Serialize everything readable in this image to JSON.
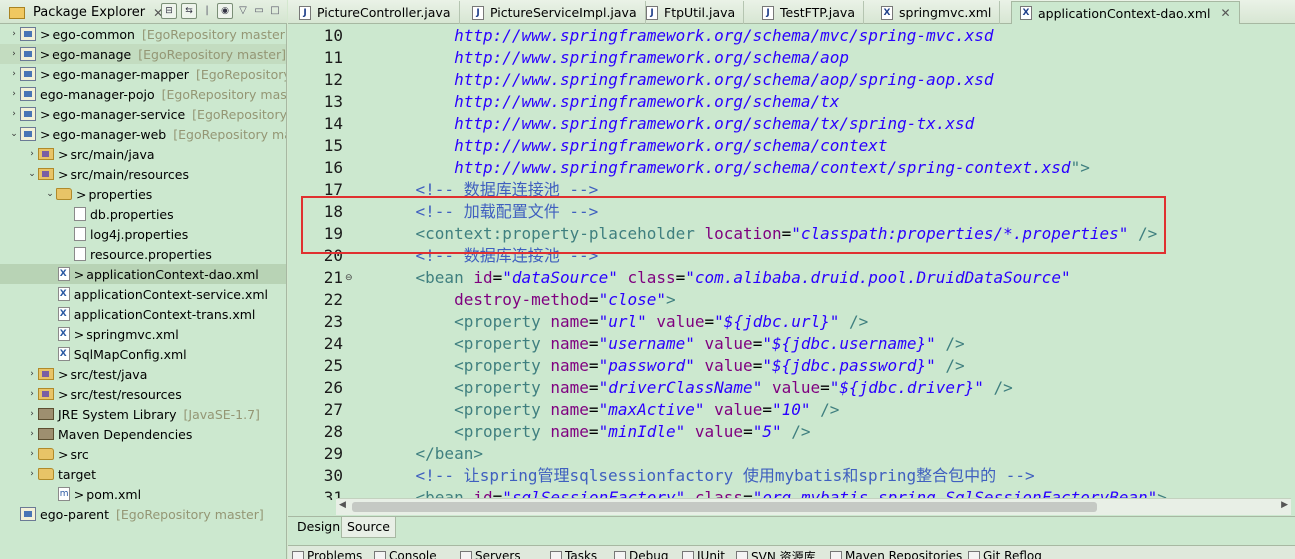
{
  "explorer": {
    "title": "Package Explorer",
    "items": [
      {
        "label": "ego-common",
        "deco": "[EgoRepository master]",
        "pre": ">"
      },
      {
        "label": "ego-manage",
        "deco": "[EgoRepository master]",
        "pre": ">"
      },
      {
        "label": "ego-manager-mapper",
        "deco": "[EgoRepository",
        "pre": ">"
      },
      {
        "label": "ego-manager-pojo",
        "deco": "[EgoRepository mas",
        "pre": ""
      },
      {
        "label": "ego-manager-service",
        "deco": "[EgoRepository",
        "pre": ">"
      },
      {
        "label": "ego-manager-web",
        "deco": "[EgoRepository ma",
        "pre": ">"
      },
      {
        "label": "src/main/java",
        "deco": "",
        "pre": ">"
      },
      {
        "label": "src/main/resources",
        "deco": "",
        "pre": ">"
      },
      {
        "label": "properties",
        "deco": "",
        "pre": ">"
      },
      {
        "label": "db.properties",
        "deco": "",
        "pre": ""
      },
      {
        "label": "log4j.properties",
        "deco": "",
        "pre": ""
      },
      {
        "label": "resource.properties",
        "deco": "",
        "pre": ""
      },
      {
        "label": "applicationContext-dao.xml",
        "deco": "",
        "pre": ">"
      },
      {
        "label": "applicationContext-service.xml",
        "deco": "",
        "pre": ""
      },
      {
        "label": "applicationContext-trans.xml",
        "deco": "",
        "pre": ""
      },
      {
        "label": "springmvc.xml",
        "deco": "",
        "pre": ">"
      },
      {
        "label": "SqlMapConfig.xml",
        "deco": "",
        "pre": ""
      },
      {
        "label": "src/test/java",
        "deco": "",
        "pre": ">"
      },
      {
        "label": "src/test/resources",
        "deco": "",
        "pre": ">"
      },
      {
        "label": "JRE System Library",
        "deco": "[JavaSE-1.7]",
        "pre": ""
      },
      {
        "label": "Maven Dependencies",
        "deco": "",
        "pre": ""
      },
      {
        "label": "src",
        "deco": "",
        "pre": ">"
      },
      {
        "label": "target",
        "deco": "",
        "pre": ""
      },
      {
        "label": "pom.xml",
        "deco": "",
        "pre": ">"
      },
      {
        "label": "ego-parent",
        "deco": "[EgoRepository master]",
        "pre": ""
      }
    ]
  },
  "editor": {
    "tabs": [
      {
        "label": "PictureController.java",
        "icon": "java-file-icon"
      },
      {
        "label": "PictureServiceImpl.java",
        "icon": "java-file-icon"
      },
      {
        "label": "FtpUtil.java",
        "icon": "java-file-icon"
      },
      {
        "label": "TestFTP.java",
        "icon": "java-file-icon"
      },
      {
        "label": "springmvc.xml",
        "icon": "xml-file-icon"
      },
      {
        "label": "applicationContext-dao.xml",
        "icon": "xml-file-icon"
      }
    ],
    "lines": [
      {
        "n": "10",
        "segs": [
          [
            "url",
            "        http://www.springframework.org/schema/mvc/spring-mvc.xsd"
          ]
        ]
      },
      {
        "n": "11",
        "segs": [
          [
            "url",
            "        http://www.springframework.org/schema/aop"
          ]
        ]
      },
      {
        "n": "12",
        "segs": [
          [
            "url",
            "        http://www.springframework.org/schema/aop/spring-aop.xsd"
          ]
        ]
      },
      {
        "n": "13",
        "segs": [
          [
            "url",
            "        http://www.springframework.org/schema/tx"
          ]
        ]
      },
      {
        "n": "14",
        "segs": [
          [
            "url",
            "        http://www.springframework.org/schema/tx/spring-tx.xsd"
          ]
        ]
      },
      {
        "n": "15",
        "segs": [
          [
            "url",
            "        http://www.springframework.org/schema/context"
          ]
        ]
      },
      {
        "n": "16",
        "segs": [
          [
            "url",
            "        http://www.springframework.org/schema/context/spring-context.xsd"
          ],
          [
            "tg",
            "\">"
          ]
        ]
      },
      {
        "n": "17",
        "segs": [
          [
            "cm",
            "    <!-- 数据库连接池 -->"
          ]
        ]
      },
      {
        "n": "18",
        "segs": [
          [
            "cm",
            "    <!-- 加载配置文件 -->"
          ]
        ]
      },
      {
        "n": "19",
        "segs": [
          [
            "tg",
            "    <context:property-placeholder "
          ],
          [
            "at",
            "location"
          ],
          [
            "pl",
            "="
          ],
          [
            "vl",
            "\"classpath:properties/*.properties\""
          ],
          [
            "tg",
            " />"
          ]
        ]
      },
      {
        "n": "20",
        "segs": [
          [
            "cm",
            "    <!-- 数据库连接池 -->"
          ]
        ]
      },
      {
        "n": "21",
        "segs": [
          [
            "tg",
            "    <bean "
          ],
          [
            "at",
            "id"
          ],
          [
            "pl",
            "="
          ],
          [
            "vl",
            "\"dataSource\""
          ],
          [
            "at",
            " class"
          ],
          [
            "pl",
            "="
          ],
          [
            "vl",
            "\"com.alibaba.druid.pool.DruidDataSource\""
          ]
        ],
        "fold": true
      },
      {
        "n": "22",
        "segs": [
          [
            "at",
            "        destroy-method"
          ],
          [
            "pl",
            "="
          ],
          [
            "vl",
            "\"close\""
          ],
          [
            "tg",
            ">"
          ]
        ]
      },
      {
        "n": "23",
        "segs": [
          [
            "tg",
            "        <property "
          ],
          [
            "at",
            "name"
          ],
          [
            "pl",
            "="
          ],
          [
            "vl",
            "\"url\""
          ],
          [
            "at",
            " value"
          ],
          [
            "pl",
            "="
          ],
          [
            "vl",
            "\"${jdbc.url}\""
          ],
          [
            "tg",
            " />"
          ]
        ]
      },
      {
        "n": "24",
        "segs": [
          [
            "tg",
            "        <property "
          ],
          [
            "at",
            "name"
          ],
          [
            "pl",
            "="
          ],
          [
            "vl",
            "\"username\""
          ],
          [
            "at",
            " value"
          ],
          [
            "pl",
            "="
          ],
          [
            "vl",
            "\"${jdbc.username}\""
          ],
          [
            "tg",
            " />"
          ]
        ]
      },
      {
        "n": "25",
        "segs": [
          [
            "tg",
            "        <property "
          ],
          [
            "at",
            "name"
          ],
          [
            "pl",
            "="
          ],
          [
            "vl",
            "\"password\""
          ],
          [
            "at",
            " value"
          ],
          [
            "pl",
            "="
          ],
          [
            "vl",
            "\"${jdbc.password}\""
          ],
          [
            "tg",
            " />"
          ]
        ]
      },
      {
        "n": "26",
        "segs": [
          [
            "tg",
            "        <property "
          ],
          [
            "at",
            "name"
          ],
          [
            "pl",
            "="
          ],
          [
            "vl",
            "\"driverClassName\""
          ],
          [
            "at",
            " value"
          ],
          [
            "pl",
            "="
          ],
          [
            "vl",
            "\"${jdbc.driver}\""
          ],
          [
            "tg",
            " />"
          ]
        ]
      },
      {
        "n": "27",
        "segs": [
          [
            "tg",
            "        <property "
          ],
          [
            "at",
            "name"
          ],
          [
            "pl",
            "="
          ],
          [
            "vl",
            "\"maxActive\""
          ],
          [
            "at",
            " value"
          ],
          [
            "pl",
            "="
          ],
          [
            "vl",
            "\"10\""
          ],
          [
            "tg",
            " />"
          ]
        ]
      },
      {
        "n": "28",
        "segs": [
          [
            "tg",
            "        <property "
          ],
          [
            "at",
            "name"
          ],
          [
            "pl",
            "="
          ],
          [
            "vl",
            "\"minIdle\""
          ],
          [
            "at",
            " value"
          ],
          [
            "pl",
            "="
          ],
          [
            "vl",
            "\"5\""
          ],
          [
            "tg",
            " />"
          ]
        ]
      },
      {
        "n": "29",
        "segs": [
          [
            "tg",
            "    </bean>"
          ]
        ]
      },
      {
        "n": "30",
        "segs": [
          [
            "cm",
            "    <!-- 让spring管理sqlsessionfactory 使用mybatis和spring整合包中的 -->"
          ]
        ]
      },
      {
        "n": "31",
        "segs": [
          [
            "tg",
            "    <bean "
          ],
          [
            "at",
            "id"
          ],
          [
            "pl",
            "="
          ],
          [
            "vl",
            "\"sqlSessionFactory\""
          ],
          [
            "at",
            " class"
          ],
          [
            "pl",
            "="
          ],
          [
            "vl",
            "\"org.mybatis.spring.SqlSessionFactoryBean\""
          ],
          [
            "tg",
            ">"
          ]
        ]
      }
    ],
    "bottom_tabs": {
      "design": "Design",
      "source": "Source"
    }
  },
  "views": [
    {
      "label": "Problems"
    },
    {
      "label": "Console"
    },
    {
      "label": "Servers"
    },
    {
      "label": "Tasks"
    },
    {
      "label": "Debug"
    },
    {
      "label": "JUnit"
    },
    {
      "label": "SVN 资源库"
    },
    {
      "label": "Maven Repositories"
    },
    {
      "label": "Git Reflog"
    }
  ],
  "colors": {
    "accent_highlight": "#e03030",
    "editor_bg": "#cce8cf"
  }
}
